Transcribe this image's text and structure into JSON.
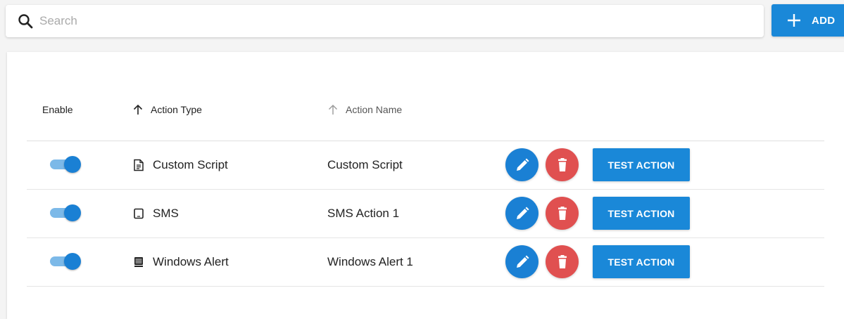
{
  "search": {
    "placeholder": "Search",
    "value": "",
    "icon": "search-icon"
  },
  "toolbar": {
    "add_label": "ADD",
    "add_icon": "plus-icon"
  },
  "table": {
    "columns": [
      {
        "label": "Enable"
      },
      {
        "label": "Action Type",
        "sort": "ascending",
        "active": true
      },
      {
        "label": "Action Name",
        "sort": "ascending",
        "active": false
      }
    ],
    "rows": [
      {
        "enabled": true,
        "type": "Custom Script",
        "type_icon": "script-document-icon",
        "name": "Custom Script",
        "test_label": "TEST ACTION"
      },
      {
        "enabled": true,
        "type": "SMS",
        "type_icon": "phone-icon",
        "name": "SMS Action 1",
        "test_label": "TEST ACTION"
      },
      {
        "enabled": true,
        "type": "Windows Alert",
        "type_icon": "alert-list-icon",
        "name": "Windows Alert 1",
        "test_label": "TEST ACTION"
      }
    ]
  },
  "colors": {
    "primary": "#1a88d8",
    "danger": "#e05050",
    "toggle_track": "#7cb9e8",
    "toggle_thumb": "#1a80d4"
  }
}
